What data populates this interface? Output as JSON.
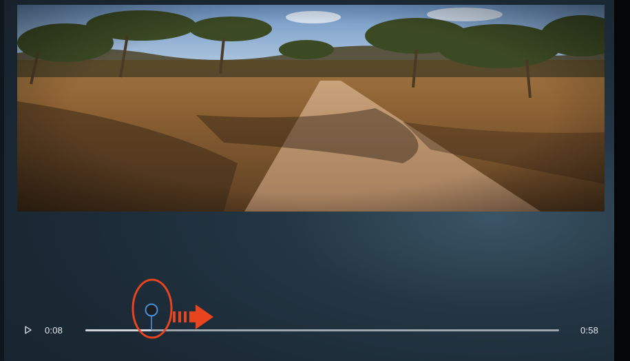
{
  "player": {
    "current_time": "0:08",
    "total_time": "0:58",
    "progress_fraction": 0.14
  },
  "icons": {
    "play": "play-icon",
    "marker": "trim-marker-icon",
    "annotation_ellipse": "highlight-ellipse-icon",
    "annotation_arrow": "right-arrow-icon"
  },
  "colors": {
    "background": "#1b2a36",
    "annotation": "#e8451f",
    "marker_stem": "#4a90d9",
    "track": "#9ea6ad",
    "text": "#e6eaee"
  }
}
